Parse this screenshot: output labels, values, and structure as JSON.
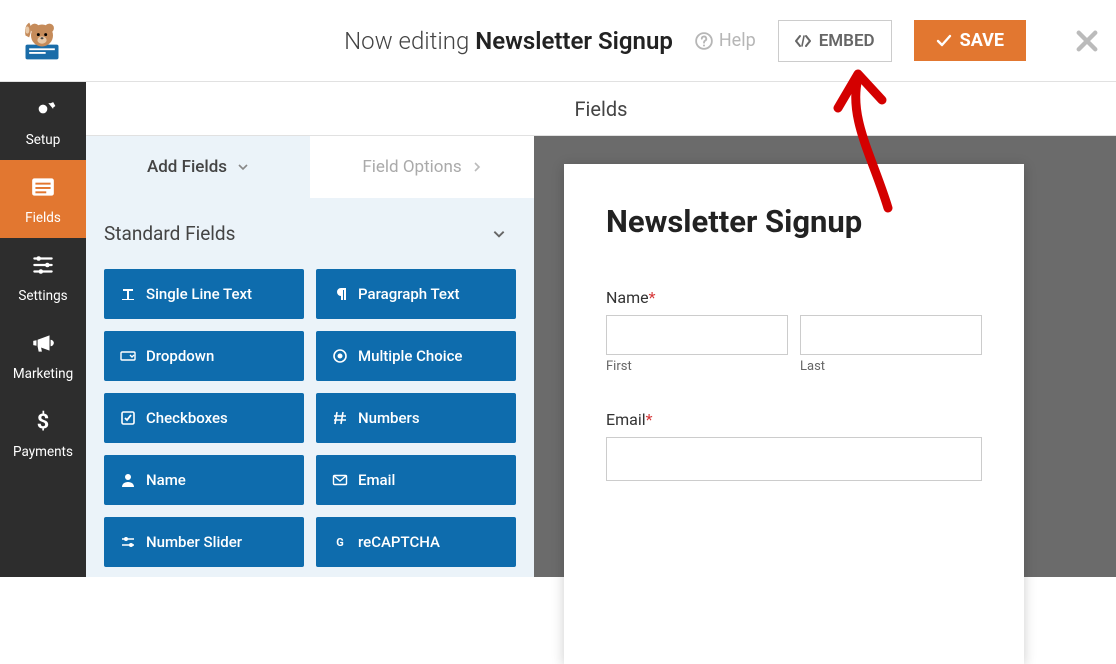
{
  "header": {
    "now_editing_label": "Now editing",
    "form_name": "Newsletter Signup",
    "help_label": "Help",
    "embed_label": "EMBED",
    "save_label": "SAVE"
  },
  "sidebar": {
    "items": [
      {
        "label": "Setup",
        "icon": "gear"
      },
      {
        "label": "Fields",
        "icon": "list"
      },
      {
        "label": "Settings",
        "icon": "sliders"
      },
      {
        "label": "Marketing",
        "icon": "bullhorn"
      },
      {
        "label": "Payments",
        "icon": "dollar"
      }
    ]
  },
  "panel": {
    "title": "Fields",
    "tabs": {
      "add": "Add Fields",
      "options": "Field Options"
    },
    "section_title": "Standard Fields",
    "fields": [
      {
        "label": "Single Line Text"
      },
      {
        "label": "Paragraph Text"
      },
      {
        "label": "Dropdown"
      },
      {
        "label": "Multiple Choice"
      },
      {
        "label": "Checkboxes"
      },
      {
        "label": "Numbers"
      },
      {
        "label": "Name"
      },
      {
        "label": "Email"
      },
      {
        "label": "Number Slider"
      },
      {
        "label": "reCAPTCHA"
      }
    ]
  },
  "preview": {
    "title": "Newsletter Signup",
    "name_label": "Name",
    "first_label": "First",
    "last_label": "Last",
    "email_label": "Email",
    "required_marker": "*"
  },
  "colors": {
    "accent": "#e27730",
    "field_chip": "#0e6cad",
    "panel_bg": "#ebf3f9"
  }
}
